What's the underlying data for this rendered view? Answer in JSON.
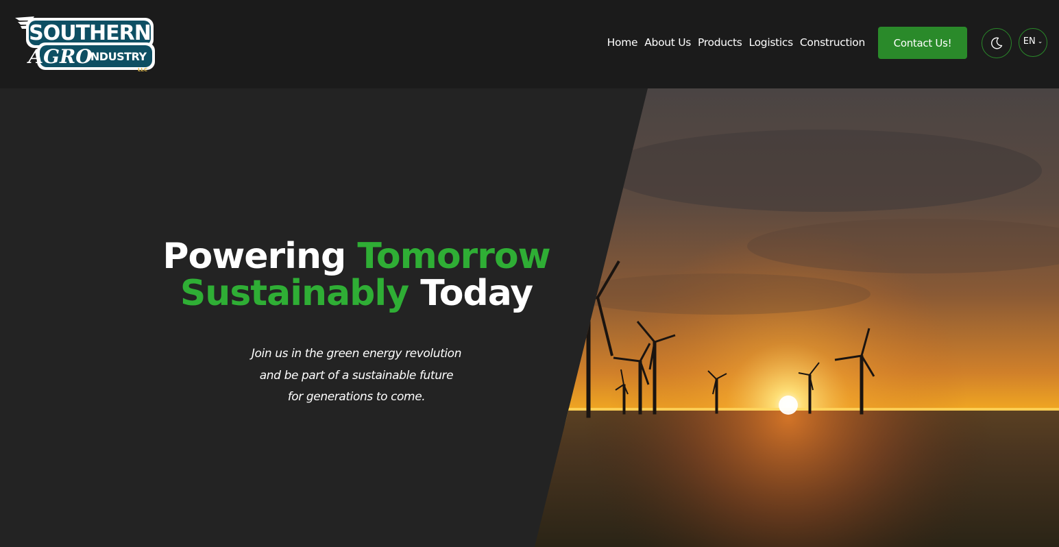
{
  "logo": {
    "line1": "SOUTHERN",
    "line2a": "AGRO",
    "line2b": "INDUSTRY",
    "suffix": "LLC"
  },
  "nav": {
    "items": [
      {
        "label": "Home"
      },
      {
        "label": "About Us"
      },
      {
        "label": "Products"
      },
      {
        "label": "Logistics"
      },
      {
        "label": "Construction"
      }
    ],
    "contact_label": "Contact Us!",
    "theme_icon": "moon-icon",
    "language": "EN"
  },
  "hero": {
    "title_part1": "Powering",
    "title_part2": "Tomorrow",
    "title_part3": "Sustainably",
    "title_part4": "Today",
    "subtitle_lines": [
      "Join us in the green energy revolution",
      "and be part of a sustainable future",
      "for generations to come."
    ],
    "image_subject": "wind-turbines-sunset-field"
  },
  "colors": {
    "header_bg": "#1b1b1b",
    "hero_bg": "#232323",
    "accent_green": "#2fae35",
    "button_green": "#2a8a2a",
    "logo_teal": "#0e4f63",
    "logo_gold": "#e0b84a"
  }
}
